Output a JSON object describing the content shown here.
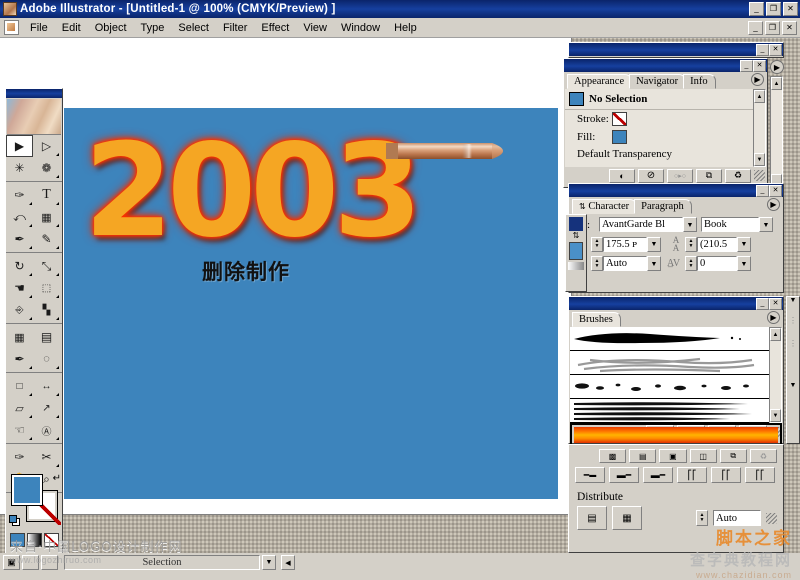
{
  "titlebar": {
    "title": "Adobe Illustrator - [Untitled-1 @ 100% (CMYK/Preview) ]",
    "app_icon": "illustrator-icon",
    "minimize": "_",
    "restore": "❐",
    "close": "✕"
  },
  "menubar": {
    "doc_icon": "document-icon",
    "items": [
      {
        "label": "File"
      },
      {
        "label": "Edit"
      },
      {
        "label": "Object"
      },
      {
        "label": "Type"
      },
      {
        "label": "Select"
      },
      {
        "label": "Filter"
      },
      {
        "label": "Effect"
      },
      {
        "label": "View"
      },
      {
        "label": "Window"
      },
      {
        "label": "Help"
      }
    ],
    "minimize": "_",
    "restore": "❐",
    "close": "✕"
  },
  "toolbox": {
    "tools": [
      {
        "name": "selection-tool",
        "glyph": "▶",
        "selected": true
      },
      {
        "name": "direct-selection-tool",
        "glyph": "▷",
        "selected": false
      },
      {
        "name": "magic-wand-tool",
        "glyph": "✳",
        "selected": false
      },
      {
        "name": "lasso-tool",
        "glyph": "❁",
        "selected": false
      },
      {
        "name": "pen-tool",
        "glyph": "✑",
        "selected": false
      },
      {
        "name": "type-tool",
        "glyph": "T",
        "selected": false
      },
      {
        "name": "line-segment-tool",
        "glyph": "╲",
        "selected": false
      },
      {
        "name": "rectangle-tool",
        "glyph": "■",
        "selected": false
      },
      {
        "name": "paintbrush-tool",
        "glyph": "✒",
        "selected": false
      },
      {
        "name": "pencil-tool",
        "glyph": "✎",
        "selected": false
      },
      {
        "name": "rotate-tool",
        "glyph": "↻",
        "selected": false
      },
      {
        "name": "scale-tool",
        "glyph": "⤡",
        "selected": false
      },
      {
        "name": "warp-tool",
        "glyph": "☚",
        "selected": false
      },
      {
        "name": "free-transform-tool",
        "glyph": "⬚",
        "selected": false
      },
      {
        "name": "symbol-sprayer-tool",
        "glyph": "⚘",
        "selected": false
      },
      {
        "name": "column-graph-tool",
        "glyph": "▐",
        "selected": false
      },
      {
        "name": "mesh-tool",
        "glyph": "▦",
        "selected": false
      },
      {
        "name": "gradient-tool",
        "glyph": "▤",
        "selected": false
      },
      {
        "name": "eyedropper-tool",
        "glyph": "✒",
        "selected": false
      },
      {
        "name": "blend-tool",
        "glyph": "◌",
        "selected": false
      },
      {
        "name": "slice-tool",
        "glyph": "⌧",
        "selected": false
      },
      {
        "name": "measure-tool",
        "glyph": "↔",
        "selected": false
      },
      {
        "name": "shear-tool",
        "glyph": "▱",
        "selected": false
      },
      {
        "name": "reshape-tool",
        "glyph": "↗",
        "selected": false
      },
      {
        "name": "direct-select-lasso-tool",
        "glyph": "↖",
        "selected": false
      },
      {
        "name": "auto-trace-tool",
        "glyph": "Ⓐ",
        "selected": false
      },
      {
        "name": "knife-tool",
        "glyph": "╱",
        "selected": false
      },
      {
        "name": "scissors-tool",
        "glyph": "✂",
        "selected": false
      },
      {
        "name": "hand-tool",
        "glyph": "✋",
        "selected": false
      },
      {
        "name": "zoom-tool",
        "glyph": "⚲",
        "selected": false
      }
    ],
    "fill_color": "#3d84bc",
    "stroke_color": "none",
    "swap_icon": "swap-fill-stroke-icon",
    "default_icon": "default-fill-stroke-icon",
    "modes": [
      {
        "name": "color-mode",
        "label": ""
      },
      {
        "name": "gradient-mode",
        "label": ""
      },
      {
        "name": "none-mode",
        "label": ""
      }
    ]
  },
  "document": {
    "artboard_color": "#3d84bc",
    "artwork": {
      "headline": "2003",
      "caption": "删除制作",
      "bullet": "bullet-graphic",
      "headline_fill": "#f5a623",
      "headline_glow": "#ff3300"
    }
  },
  "appearance_panel": {
    "tabs": [
      {
        "label": "Appearance",
        "active": true
      },
      {
        "label": "Navigator",
        "active": false
      },
      {
        "label": "Info",
        "active": false
      }
    ],
    "selection_state": "No Selection",
    "stroke_label": "Stroke:",
    "stroke_value": "none",
    "fill_label": "Fill:",
    "fill_value": "#3d84bc",
    "transparency_label": "Default Transparency",
    "footer_buttons": [
      {
        "name": "new-art-has-basic-appearance-icon",
        "glyph": "◑"
      },
      {
        "name": "clear-appearance-icon",
        "glyph": "⊘"
      },
      {
        "name": "reduce-to-basic-appearance-icon",
        "glyph": "○▸○"
      },
      {
        "name": "duplicate-item-icon",
        "glyph": "⧉"
      },
      {
        "name": "delete-item-icon",
        "glyph": "Ὕ1"
      }
    ]
  },
  "character_panel": {
    "tabs": [
      {
        "label": "Character",
        "active": true
      },
      {
        "label": "Paragraph",
        "active": false
      }
    ],
    "font_label": "ont:",
    "font_family": "AvantGarde Bl",
    "font_style": "Book",
    "size_icon": "font-size-icon",
    "size_value": "175.5 ᴘ",
    "leading_icon": "leading-icon",
    "leading_value": "(210.5",
    "kerning_icon": "kerning-icon",
    "kerning_value": "Auto",
    "tracking_icon": "tracking-icon",
    "tracking_value": "0"
  },
  "brushes_panel": {
    "tabs": [
      {
        "label": "Brushes",
        "active": true
      }
    ],
    "brushes": [
      {
        "name": "brush-tapered-black",
        "type": "blob"
      },
      {
        "name": "brush-scribble-gray",
        "type": "scribble"
      },
      {
        "name": "brush-spatter-dots",
        "type": "spatter"
      },
      {
        "name": "brush-thin-strokes",
        "type": "lines"
      },
      {
        "name": "brush-orange-gradient",
        "type": "gradient",
        "selected": true
      }
    ],
    "footer_buttons": [
      {
        "name": "remove-brush-stroke-icon",
        "glyph": "✕"
      },
      {
        "name": "options-of-object-icon",
        "glyph": "╱≡"
      },
      {
        "name": "new-brush-icon",
        "glyph": "⧉"
      },
      {
        "name": "delete-brush-icon",
        "glyph": "Ὕ1"
      }
    ]
  },
  "align_panel": {
    "distribute_label": "Distribute",
    "spacing_value": "Auto",
    "align_buttons": [
      {
        "name": "align-vertical-top-icon"
      },
      {
        "name": "align-vertical-center-icon"
      },
      {
        "name": "align-vertical-bottom-icon"
      },
      {
        "name": "distribute-horizontal-left-icon"
      },
      {
        "name": "distribute-horizontal-center-icon"
      },
      {
        "name": "distribute-horizontal-right-icon"
      }
    ],
    "distribute_buttons": [
      {
        "name": "distribute-spacing-vertical-icon"
      },
      {
        "name": "distribute-spacing-horizontal-icon"
      }
    ]
  },
  "statusbar": {
    "status_text": "Selection",
    "page_icon": "page-indicator-icon"
  },
  "watermarks": {
    "left_line1": "来自·中国LOGO设计制作网",
    "left_line2": "www.logozhiruo.com",
    "right_line1": "脚本之家",
    "right_line2": "查字典教程网",
    "right_line3": "www.chazidian.com"
  }
}
